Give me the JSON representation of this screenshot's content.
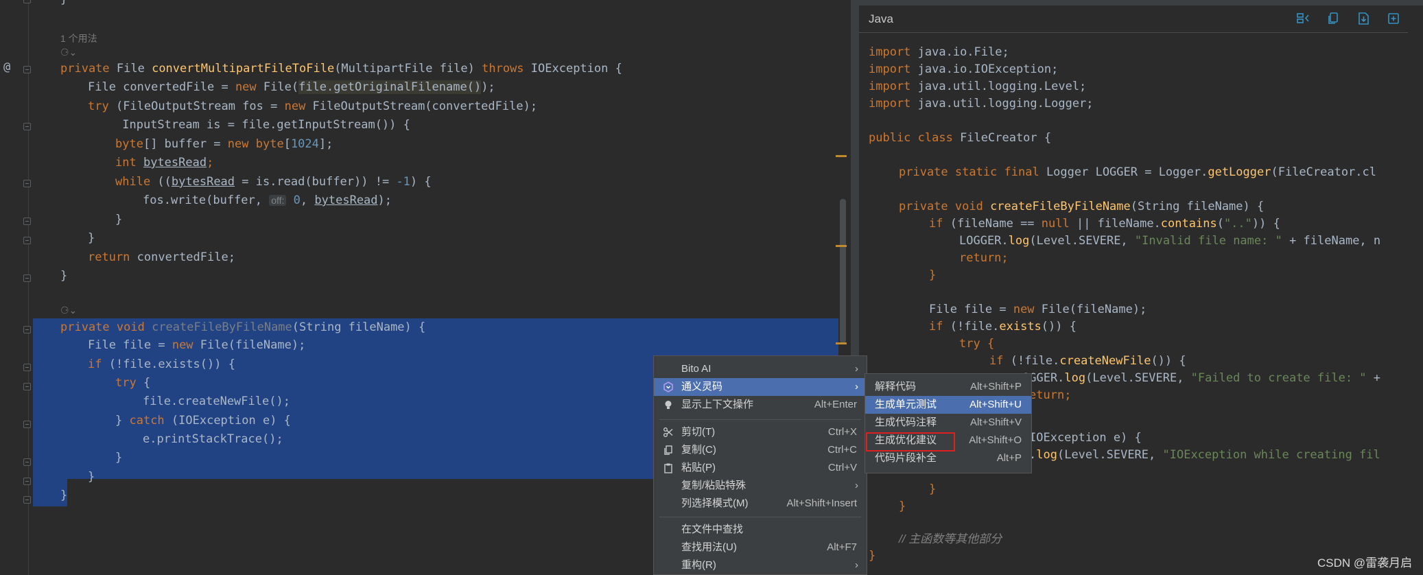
{
  "editor": {
    "usage_hint": "1 个用法",
    "annotation_at": "@",
    "lines": {
      "l1_private": "private ",
      "l1_type": "File ",
      "l1_name": "convertMultipartFileToFile",
      "l1_params": "(MultipartFile file) ",
      "l1_throws": "throws ",
      "l1_exc": "IOException {",
      "l2_pre": "File convertedFile = ",
      "l2_new": "new ",
      "l2_cls": "File(",
      "l2_hl": "file.getOriginalFilename()",
      "l2_end": ");",
      "l3_try": "try ",
      "l3_rest": "(FileOutputStream fos = ",
      "l3_new": "new ",
      "l3_end": "FileOutputStream(convertedFile);",
      "l4": " InputStream is = file.getInputStream()) {",
      "l5_byte": "byte",
      "l5_mid": "[] buffer = ",
      "l5_new": "new ",
      "l5_byte2": "byte",
      "l5_br": "[",
      "l5_num": "1024",
      "l5_end": "];",
      "l6_int": "int ",
      "l6_var": "bytesRead",
      "l6_end": ";",
      "l7_while": "while ",
      "l7_a": "((",
      "l7_var": "bytesRead",
      "l7_b": " = is.read(buffer)) != ",
      "l7_num": "-1",
      "l7_c": ") {",
      "l8_a": "fos.write(buffer, ",
      "l8_hint": "off:",
      "l8_num": " 0",
      "l8_b": ", ",
      "l8_var": "bytesRead",
      "l8_c": ");",
      "l9": "}",
      "l10": "}",
      "l11_ret": "return ",
      "l11_rest": "convertedFile;",
      "l12": "}",
      "l13_private": "private ",
      "l13_void": "void ",
      "l13_name": "createFileByFileName",
      "l13_rest": "(String fileName) {",
      "l14_a": "File file = ",
      "l14_new": "new ",
      "l14_b": "File(fileName);",
      "l15_if": "if ",
      "l15_rest": "(!file.exists()) {",
      "l16_try": "try ",
      "l16_rest": "{",
      "l17": "file.createNewFile();",
      "l18_a": "} ",
      "l18_catch": "catch ",
      "l18_b": "(IOException e) {",
      "l19": "e.printStackTrace();",
      "l20": "}",
      "l21": "}",
      "l22": "}"
    }
  },
  "panel": {
    "language": "Java",
    "code": {
      "p1_kw": "import ",
      "p1": "java.io.File;",
      "p2_kw": "import ",
      "p2": "java.io.IOException;",
      "p3_kw": "import ",
      "p3": "java.util.logging.Level;",
      "p4_kw": "import ",
      "p4": "java.util.logging.Logger;",
      "p5_kw": "public class ",
      "p5": "FileCreator {",
      "p6_kw": "private static final ",
      "p6_a": "Logger LOGGER = Logger.",
      "p6_f": "getLogger",
      "p6_b": "(FileCreator.cl",
      "p7_kw": "private void ",
      "p7_f": "createFileByFileName",
      "p7_b": "(String fileName) {",
      "p8_kw": "if ",
      "p8_a": "(fileName == ",
      "p8_null": "null ",
      "p8_b": "|| fileName.",
      "p8_f": "contains",
      "p8_c": "(",
      "p8_s": "\"..\"",
      "p8_d": ")) {",
      "p9_a": "LOGGER.",
      "p9_f": "log",
      "p9_b": "(Level.SEVERE, ",
      "p9_s": "\"Invalid file name: \" ",
      "p9_c": "+ fileName, n",
      "p10_kw": "return",
      "p10": ";",
      "p11": "}",
      "p12_a": "File file = ",
      "p12_new": "new ",
      "p12_b": "File(fileName);",
      "p13_kw": "if ",
      "p13_a": "(!file.",
      "p13_f": "exists",
      "p13_b": "()) {",
      "p14_kw": "try ",
      "p14": "{",
      "p15_kw": "if ",
      "p15_a": "(!file.",
      "p15_f": "createNewFile",
      "p15_b": "()) {",
      "p16_a": "OGGER.",
      "p16_f": "log",
      "p16_b": "(Level.SEVERE, ",
      "p16_s": "\"Failed to create file: \" ",
      "p16_c": "+",
      "p17_kw": "eturn",
      "p17": ";",
      "p18": "IOException e) {",
      "p19_a": ".",
      "p19_f": "log",
      "p19_b": "(Level.SEVERE, ",
      "p19_s": "\"IOException while creating fil",
      "p20": "}",
      "p21": "}",
      "p22": "// 主函数等其他部分",
      "p23": "}"
    }
  },
  "context_menu": {
    "items": [
      {
        "label": "Bito AI",
        "shortcut": ""
      },
      {
        "label": "通义灵码",
        "shortcut": ""
      },
      {
        "label": "显示上下文操作",
        "shortcut": "Alt+Enter"
      },
      {
        "label": "剪切(T)",
        "shortcut": "Ctrl+X"
      },
      {
        "label": "复制(C)",
        "shortcut": "Ctrl+C"
      },
      {
        "label": "粘贴(P)",
        "shortcut": "Ctrl+V"
      },
      {
        "label": "复制/粘贴特殊",
        "shortcut": ""
      },
      {
        "label": "列选择模式(M)",
        "shortcut": "Alt+Shift+Insert"
      },
      {
        "label": "在文件中查找",
        "shortcut": ""
      },
      {
        "label": "查找用法(U)",
        "shortcut": "Alt+F7"
      },
      {
        "label": "重构(R)",
        "shortcut": ""
      }
    ]
  },
  "submenu": {
    "items": [
      {
        "label": "解释代码",
        "shortcut": "Alt+Shift+P"
      },
      {
        "label": "生成单元测试",
        "shortcut": "Alt+Shift+U"
      },
      {
        "label": "生成代码注释",
        "shortcut": "Alt+Shift+V"
      },
      {
        "label": "生成优化建议",
        "shortcut": "Alt+Shift+O"
      },
      {
        "label": "代码片段补全",
        "shortcut": "Alt+P"
      }
    ]
  },
  "watermark": "CSDN @雷袭月启",
  "colors": {
    "selection": "#214283",
    "menu_active": "#4b6eaf",
    "highlight_box": "#e02020",
    "keyword": "#cc7832",
    "method": "#ffc66d",
    "string": "#6a8759"
  }
}
